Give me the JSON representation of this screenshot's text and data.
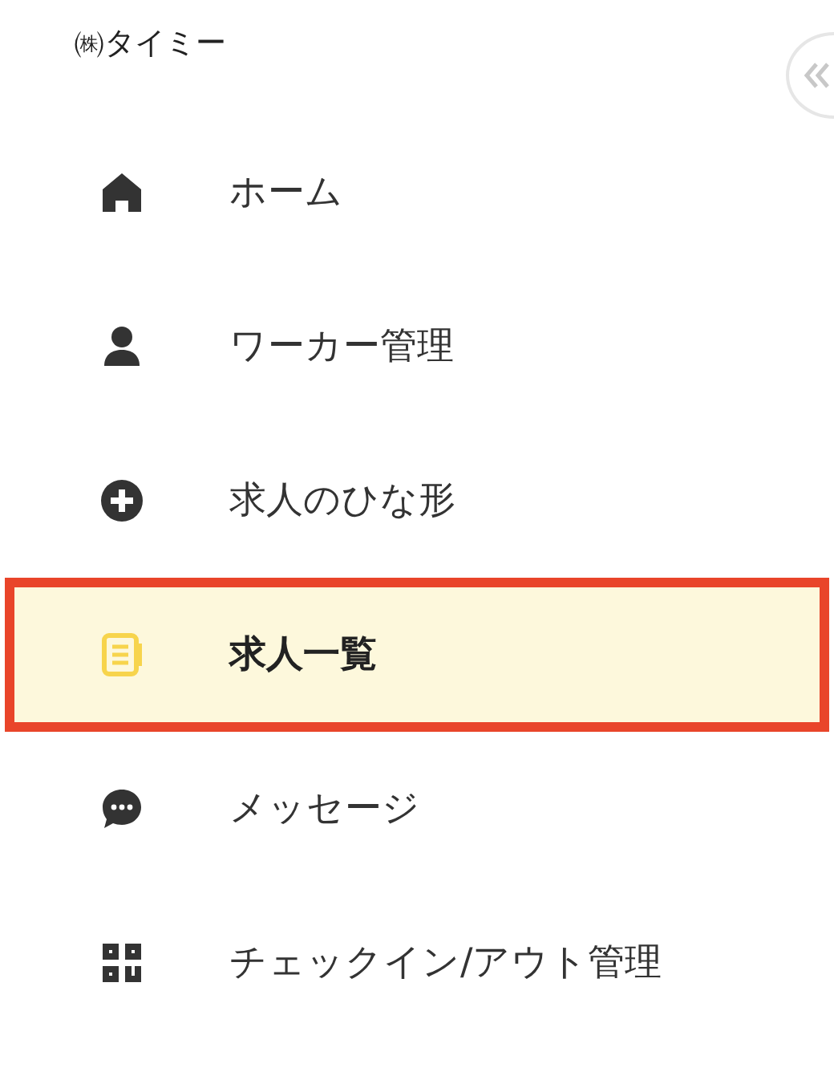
{
  "sidebar": {
    "company": "㈱タイミー",
    "items": [
      {
        "kind": "home",
        "label": "ホーム",
        "selected": false
      },
      {
        "kind": "person",
        "label": "ワーカー管理",
        "selected": false
      },
      {
        "kind": "plus",
        "label": "求人のひな形",
        "selected": false
      },
      {
        "kind": "list",
        "label": "求人一覧",
        "selected": true
      },
      {
        "kind": "chat",
        "label": "メッセージ",
        "selected": false
      },
      {
        "kind": "qr",
        "label": "チェックイン/アウト管理",
        "selected": false
      }
    ]
  }
}
